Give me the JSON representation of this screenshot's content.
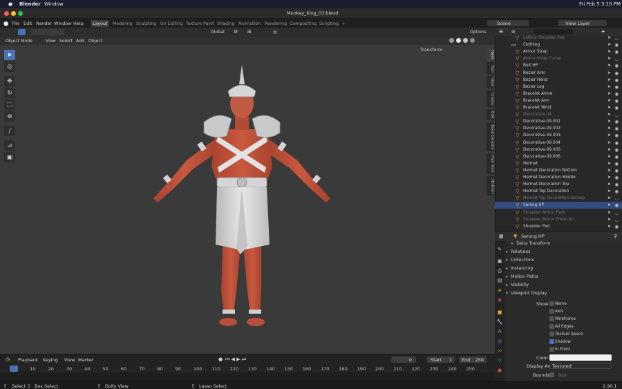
{
  "mac_menubar": {
    "apple": "",
    "app_name": "Blender",
    "window_menu": "Window",
    "datetime": "Fri Feb 5  3:10 PM"
  },
  "title_bar": {
    "title": "Monkey_King_03.blend"
  },
  "top_menu": [
    "File",
    "Edit",
    "Render",
    "Window",
    "Help"
  ],
  "workspace_tabs": [
    "Layout",
    "Modeling",
    "Sculpting",
    "UV Editing",
    "Texture Paint",
    "Shading",
    "Animation",
    "Rendering",
    "Compositing",
    "Scripting",
    "+"
  ],
  "active_workspace": "Layout",
  "scene": {
    "scene_name": "Scene",
    "view_layer": "View Layer"
  },
  "viewport": {
    "orientation": "Global",
    "options_label": "Options",
    "mode": "Object Mode",
    "menus": [
      "View",
      "Select",
      "Add",
      "Object"
    ],
    "transform_panel": "Transform",
    "side_tabs": [
      "Item",
      "Tool",
      "View",
      "Create",
      "Edit",
      "Texel Density",
      "Hair Tool",
      "3D-Print"
    ]
  },
  "timeline": {
    "menus": [
      "Playback",
      "Keying",
      "View",
      "Marker"
    ],
    "current_frame": "0",
    "start_label": "Start",
    "start_value": "1",
    "end_label": "End",
    "end_value": "250",
    "ticks": [
      "0",
      "10",
      "20",
      "30",
      "40",
      "50",
      "60",
      "70",
      "80",
      "90",
      "100",
      "110",
      "120",
      "130",
      "140",
      "150",
      "160",
      "170",
      "180",
      "190",
      "200",
      "210",
      "220",
      "230",
      "240",
      "250"
    ]
  },
  "status_bar": {
    "select": "Select",
    "box_select": "Box Select",
    "dolly_view": "Dolly View",
    "lasso_select": "Lasso Select",
    "version": "2.90.1"
  },
  "outliner": {
    "rows": [
      {
        "label": "Lattice Shoulder Pad",
        "dim": true
      },
      {
        "label": "Clothing",
        "collection": true
      },
      {
        "label": "Armor Strap"
      },
      {
        "label": "Armor Strap Curve",
        "dim": true
      },
      {
        "label": "Belt HP"
      },
      {
        "label": "Bezier Arm"
      },
      {
        "label": "Bezier Hand"
      },
      {
        "label": "Bezier Leg"
      },
      {
        "label": "Bracelet Ankle"
      },
      {
        "label": "Bracelet Arm"
      },
      {
        "label": "Bracelet Wrist"
      },
      {
        "label": "Decorative-04",
        "dim": true
      },
      {
        "label": "Decorative-09.001"
      },
      {
        "label": "Decorative-09.002"
      },
      {
        "label": "Decorative-09.003"
      },
      {
        "label": "Decorative-09.004"
      },
      {
        "label": "Decorative-09.005"
      },
      {
        "label": "Decorative-09.006"
      },
      {
        "label": "Helmet"
      },
      {
        "label": "Helmet Decoration Bottom"
      },
      {
        "label": "Helmet Decoration Middle"
      },
      {
        "label": "Helmet Decoration Top"
      },
      {
        "label": "Helmet Top Decoration"
      },
      {
        "label": "Helmet Top Decoration Backup",
        "dim": true
      },
      {
        "label": "Sarong HP",
        "selected": true
      },
      {
        "label": "Shoulder Armor Pads",
        "dim": true
      },
      {
        "label": "Shoulder Armor Protector",
        "dim": true
      },
      {
        "label": "Shoulder Pad"
      }
    ]
  },
  "properties": {
    "object_name": "Sarong HP",
    "sections": [
      "Delta Transform",
      "Relations",
      "Collections",
      "Instancing",
      "Motion Paths",
      "Visibility",
      "Viewport Display"
    ],
    "show_label": "Show",
    "checkboxes": [
      {
        "label": "Name",
        "checked": false
      },
      {
        "label": "Axis",
        "checked": false
      },
      {
        "label": "Wireframe",
        "checked": false
      },
      {
        "label": "All Edges",
        "checked": false
      },
      {
        "label": "Texture Space",
        "checked": false
      },
      {
        "label": "Shadow",
        "checked": true
      },
      {
        "label": "In Front",
        "checked": false
      }
    ],
    "color_label": "Color",
    "display_as_label": "Display As",
    "display_as_value": "Textured",
    "bounds_label": "Bounds",
    "bounds_value": "Box"
  },
  "colors": {
    "accent": "#4772b3",
    "skin": "#c4573f",
    "cloth": "#d9d9d9",
    "viewport_bg": "#3a3a3a"
  }
}
